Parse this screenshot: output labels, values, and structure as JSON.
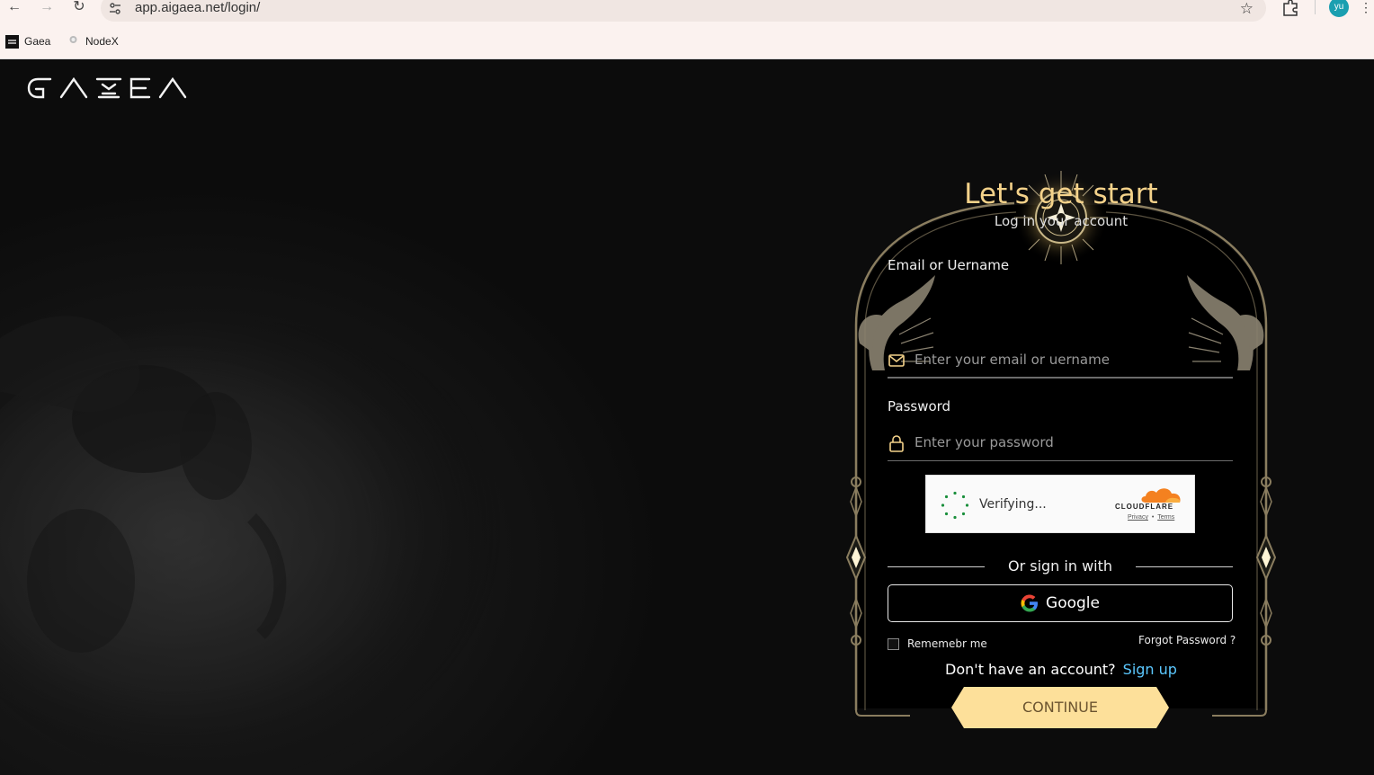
{
  "browser": {
    "url": "app.aigaea.net/login/",
    "profile_initials": "yu",
    "bookmarks": [
      {
        "label": "Gaea"
      },
      {
        "label": "NodeX"
      }
    ]
  },
  "brand": {
    "logo_text": "GAEA"
  },
  "login": {
    "title": "Let's get start",
    "subtitle": "Log in your account",
    "email_label": "Email or Uername",
    "email_placeholder": "Enter your email or uername",
    "password_label": "Password",
    "password_placeholder": "Enter your password",
    "captcha": {
      "status": "Verifying...",
      "provider": "CLOUDFLARE",
      "privacy": "Privacy",
      "separator": "•",
      "terms": "Terms"
    },
    "or_text": "Or sign in with",
    "google_label": "Google",
    "remember_label": "Rememebr me",
    "forgot_label": "Forgot Password ?",
    "no_account": "Don't have an account?",
    "signup_label": "Sign up",
    "continue_label": "CONTINUE"
  },
  "colors": {
    "accent_gold": "#f4d28a",
    "button_fill": "#fde09a",
    "link_blue": "#5bc8ff",
    "frame": "#8a7d5f"
  }
}
